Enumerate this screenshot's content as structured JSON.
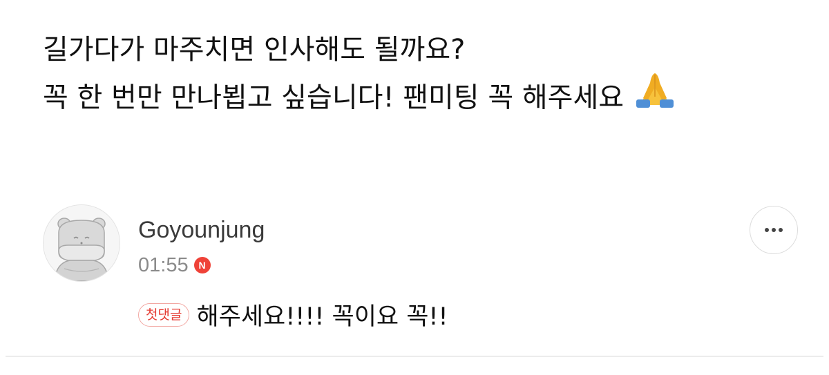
{
  "post": {
    "lines": [
      "길가다가 마주치면 인사해도 될까요?",
      "꼭 한 번만 만나뵙고 싶습니다! 팬미팅 꼭 해주세요"
    ],
    "emoji_icon": "folded-hands-emoji"
  },
  "comment": {
    "author": "Goyounjung",
    "time": "01:55",
    "new_badge": "N",
    "first_comment_badge": "첫댓글",
    "text": "해주세요!!!! 꼭이요 꼭!!",
    "avatar_icon": "hippo-default-avatar",
    "more_icon": "more-horizontal-icon"
  },
  "colors": {
    "badge_red": "#ef4238",
    "first_comment_red": "#e53b32",
    "muted_gray": "#8a8a8a"
  }
}
